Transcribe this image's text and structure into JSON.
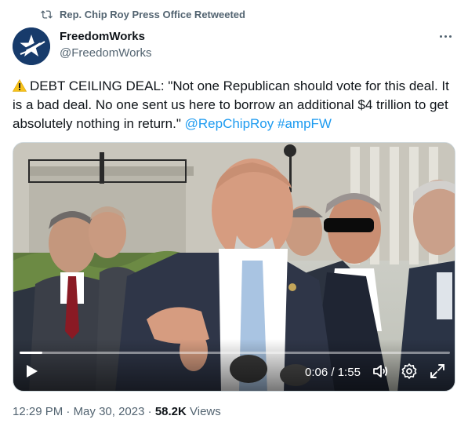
{
  "retweet": {
    "label": "Rep. Chip Roy Press Office Retweeted",
    "icon": "retweet-icon"
  },
  "author": {
    "display_name": "FreedomWorks",
    "handle": "@FreedomWorks",
    "avatar_icon": "star-logo-icon"
  },
  "more_icon": "more-horizontal-icon",
  "tweet": {
    "warning_icon": "warning-icon",
    "body": "DEBT CEILING DEAL: \"Not one Republican should vote for this deal. It is a bad deal. No one sent us here to borrow an additional $4 trillion to get absolutely nothing in return.\"",
    "mention": "@RepChipRoy",
    "hashtag": "#ampFW",
    "link_color": "#1d9bf0"
  },
  "video": {
    "elapsed": "0:06",
    "separator": " / ",
    "duration": "1:55",
    "progress_fraction": 0.052,
    "icons": [
      "play-icon",
      "volume-icon",
      "settings-icon",
      "fullscreen-icon"
    ]
  },
  "meta": {
    "time": "12:29 PM",
    "dot": " · ",
    "date": "May 30, 2023",
    "views_count": "58.2K",
    "views_label": " Views"
  }
}
